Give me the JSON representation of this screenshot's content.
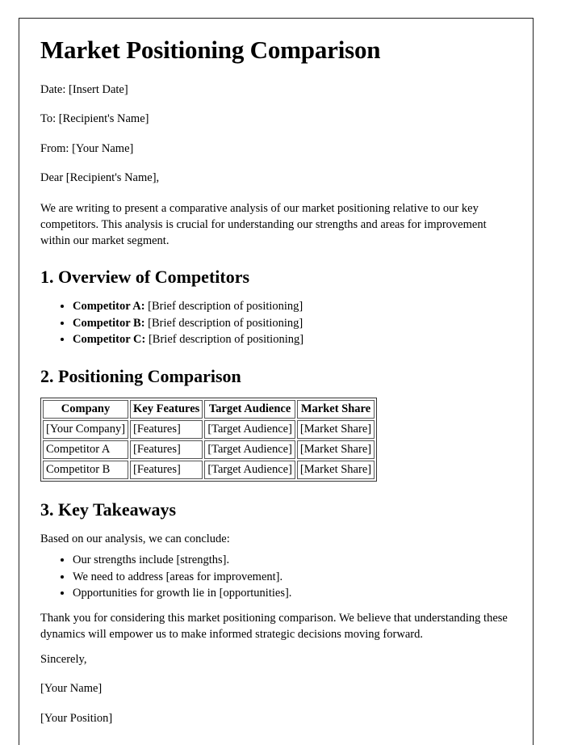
{
  "document": {
    "title": "Market Positioning Comparison",
    "header_lines": [
      "Date: [Insert Date]",
      "To: [Recipient's Name]",
      "From: [Your Name]",
      "Dear [Recipient's Name],"
    ],
    "intro_paragraph": "We are writing to present a comparative analysis of our market positioning relative to our key competitors. This analysis is crucial for understanding our strengths and areas for improvement within our market segment.",
    "sections": [
      {
        "heading": "1. Overview of Competitors",
        "bullets": [
          {
            "label": "Competitor A:",
            "text": "[Brief description of positioning]"
          },
          {
            "label": "Competitor B:",
            "text": "[Brief description of positioning]"
          },
          {
            "label": "Competitor C:",
            "text": "[Brief description of positioning]"
          }
        ]
      },
      {
        "heading": "2. Positioning Comparison"
      },
      {
        "heading": "3. Key Takeaways",
        "lead_in": "Based on our analysis, we can conclude:",
        "bullets": [
          "Our strengths include [strengths].",
          "We need to address [areas for improvement].",
          "Opportunities for growth lie in [opportunities]."
        ]
      }
    ],
    "table": {
      "columns": [
        "Company",
        "Key Features",
        "Target Audience",
        "Market Share"
      ],
      "rows": [
        [
          "[Your Company]",
          "[Features]",
          "[Target Audience]",
          "[Market Share]"
        ],
        [
          "Competitor A",
          "[Features]",
          "[Target Audience]",
          "[Market Share]"
        ],
        [
          "Competitor B",
          "[Features]",
          "[Target Audience]",
          "[Market Share]"
        ]
      ]
    },
    "closing_paragraph": "Thank you for considering this market positioning comparison. We believe that understanding these dynamics will empower us to make informed strategic decisions moving forward.",
    "signoff": "Sincerely,",
    "signature_name": "[Your Name]",
    "signature_position": "[Your Position]"
  }
}
